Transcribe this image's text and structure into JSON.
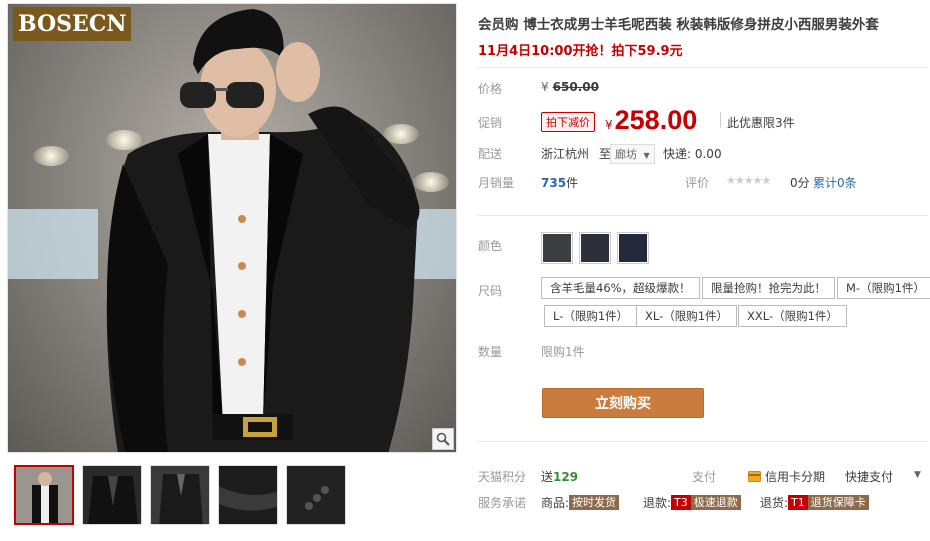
{
  "brand_logo": "BOSECN",
  "product": {
    "title": "会员购 博士衣成男士羊毛呢西装 秋装韩版修身拼皮小西服男装外套",
    "subtitle": "11月4日10:00开抢！拍下59.9元"
  },
  "price": {
    "label": "价格",
    "currency": "¥",
    "original": "650.00",
    "promo_label": "促销",
    "promo_badge": "拍下减价",
    "promo_value": "258.00",
    "promo_note": "此优惠限3件"
  },
  "shipping": {
    "label": "配送",
    "from": "浙江杭州",
    "to_prefix": "至",
    "to_value": "廊坊",
    "fee_label": "快递: 0.00"
  },
  "sales": {
    "label": "月销量",
    "count": "735",
    "unit": "件",
    "rating_label": "评价",
    "stars": "★★★★★",
    "score": "0分",
    "rating_count": "累计0条"
  },
  "color": {
    "label": "颜色",
    "swatches": [
      "#3b3d43",
      "#2d3038",
      "#23283a"
    ]
  },
  "size": {
    "label": "尺码",
    "options": [
      "含羊毛量46%，超级爆款！",
      "限量抢购！抢完为此！",
      "M-（限购1件）",
      "L-（限购1件）",
      "XL-（限购1件）",
      "XXL-（限购1件）"
    ]
  },
  "quantity": {
    "label": "数量",
    "text": "限购1件"
  },
  "buy_button": "立刻购买",
  "tmall_points": {
    "label": "天猫积分",
    "prefix": "送",
    "value": "129"
  },
  "payment": {
    "label": "支付",
    "credit": "信用卡分期",
    "quick": "快捷支付",
    "arrow": "▼"
  },
  "service": {
    "label": "服务承诺",
    "goods_label": "商品:",
    "goods_tag": "按时发货",
    "refund_label": "退款:",
    "refund_code": "T3",
    "refund_tag": "极速退款",
    "return_label": "退货:",
    "return_code": "T1",
    "return_tag": "退货保障卡"
  },
  "colors": {
    "accent_red": "#c40000",
    "buy_button": "#c97c3e",
    "link_blue": "#2a6aa8"
  }
}
